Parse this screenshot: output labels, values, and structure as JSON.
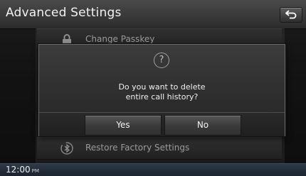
{
  "header": {
    "title": "Advanced Settings"
  },
  "menu": {
    "items": [
      {
        "label": "Change Passkey",
        "icon": "lock-icon"
      },
      {
        "label": "Restore Factory Settings",
        "icon": "bluetooth-reset-icon"
      }
    ]
  },
  "dialog": {
    "icon": "question-icon",
    "icon_glyph": "?",
    "message_line1": "Do you want to delete",
    "message_line2": "entire call history?",
    "yes_label": "Yes",
    "no_label": "No"
  },
  "status": {
    "time": "12:00",
    "ampm": "PM"
  },
  "colors": {
    "background": "#1d1d1d",
    "dialog_border": "#6a6a6a",
    "status_bar": "#1a232e"
  }
}
